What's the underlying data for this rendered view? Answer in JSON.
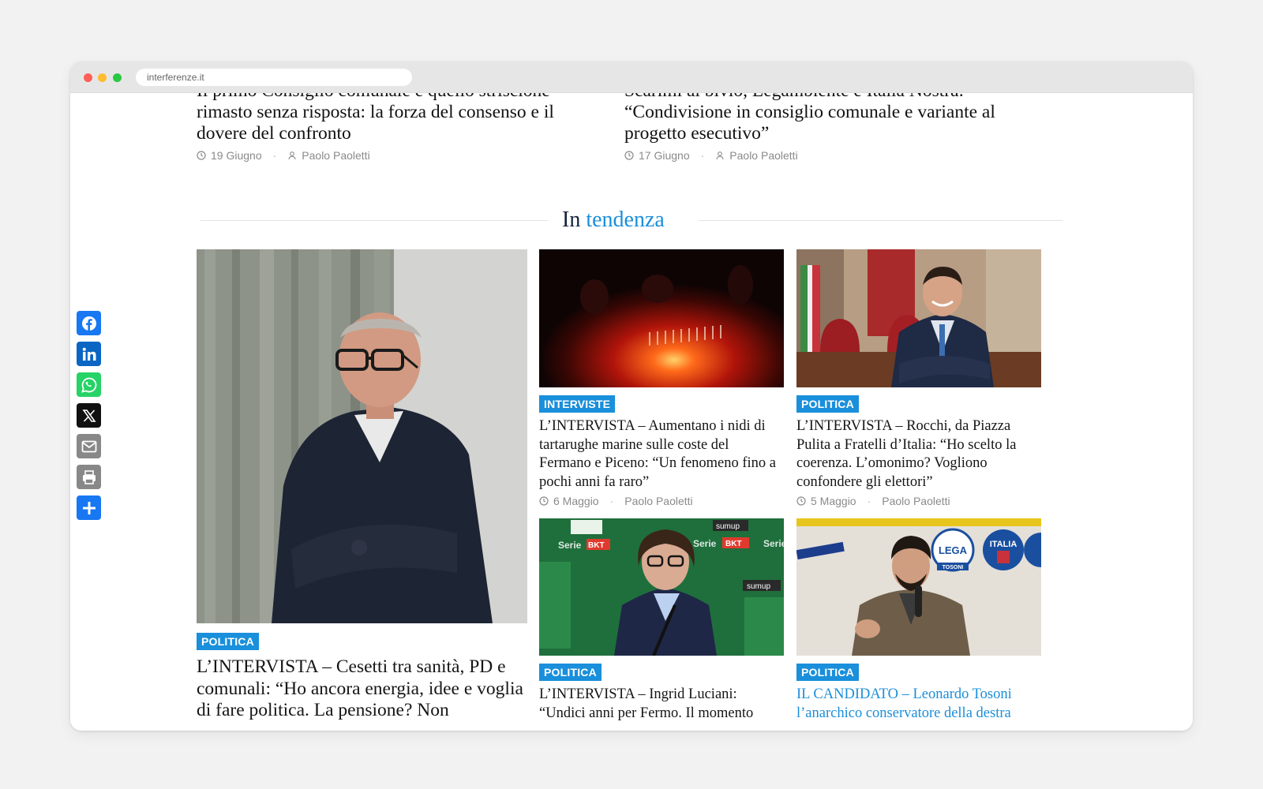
{
  "browser": {
    "url": "interferenze.it"
  },
  "prev_articles": [
    {
      "title_partial": "Il primo Consiglio comunale e quello striscione",
      "title_rest": "rimasto senza risposta: la forza del consenso e il dovere del confronto",
      "date": "19 Giugno",
      "author": "Paolo Paoletti"
    },
    {
      "title_partial": "Scarimi al bivio, Legambiente e Italia Nostra:",
      "title_rest": "“Condivisione in consiglio comunale e variante al progetto esecutivo”",
      "date": "17 Giugno",
      "author": "Paolo Paoletti"
    }
  ],
  "section": {
    "title_plain": "In",
    "title_accent": "tendenza"
  },
  "cards": {
    "featured": {
      "category": "POLITICA",
      "title": "L’INTERVISTA – Cesetti tra sanità, PD e comunali: “Ho ancora energia, idee e voglia di fare politica. La pensione? Non"
    },
    "turtles": {
      "category": "INTERVISTE",
      "title": "L’INTERVISTA – Aumentano i nidi di tartarughe marine sulle coste del Fermano e Piceno: “Un fenomeno fino a pochi anni fa raro”",
      "date": "6 Maggio",
      "author": "Paolo Paoletti"
    },
    "rocchi": {
      "category": "POLITICA",
      "title": "L’INTERVISTA – Rocchi, da Piazza Pulita a Fratelli d’Italia: “Ho scelto la coerenza. L’omonimo? Vogliono confondere gli elettori”",
      "date": "5 Maggio",
      "author": "Paolo Paoletti"
    },
    "luciani": {
      "category": "POLITICA",
      "title": "L’INTERVISTA – Ingrid Luciani: “Undici anni per Fermo. Il momento"
    },
    "tosoni": {
      "category": "POLITICA",
      "title": "IL CANDIDATO – Leonardo Tosoni l’anarchico conservatore della destra"
    }
  },
  "image_text": {
    "lega_logo": "LEGA",
    "lega_sub": "TOSONI",
    "italia_logo": "ITALIA",
    "sponsor_serie": "Serie",
    "sponsor_bkt": "BKT",
    "sponsor_sumup": "sumup"
  },
  "share": [
    {
      "name": "facebook",
      "color": "#1877f2"
    },
    {
      "name": "linkedin",
      "color": "#0a66c2"
    },
    {
      "name": "whatsapp",
      "color": "#25d366"
    },
    {
      "name": "x",
      "color": "#111111"
    },
    {
      "name": "email",
      "color": "#888888"
    },
    {
      "name": "print",
      "color": "#888888"
    },
    {
      "name": "share",
      "color": "#1877f2"
    }
  ],
  "colors": {
    "accent": "#1a8fdb",
    "heading": "#14223d"
  }
}
